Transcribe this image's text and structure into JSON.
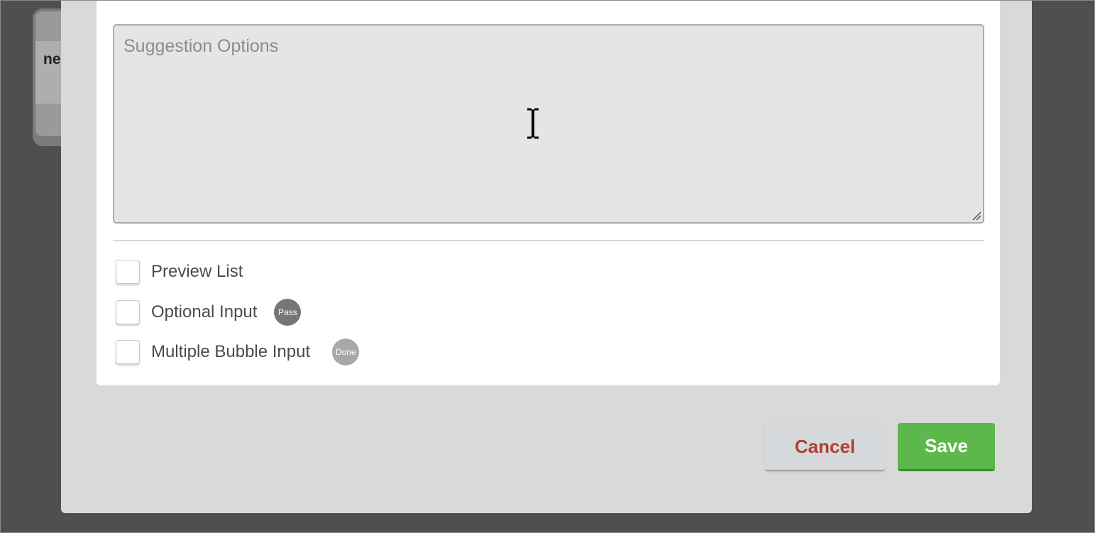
{
  "background": {
    "card_text": "ne"
  },
  "dialog": {
    "suggestion_options": {
      "value": "",
      "placeholder": "Suggestion Options"
    },
    "options": [
      {
        "label": "Preview List",
        "checked": false,
        "badge": null
      },
      {
        "label": "Optional Input",
        "checked": false,
        "badge": "Pass"
      },
      {
        "label": "Multiple Bubble Input",
        "checked": false,
        "badge": "Done"
      }
    ],
    "buttons": {
      "cancel_label": "Cancel",
      "save_label": "Save"
    }
  },
  "colors": {
    "overlay": "#4f4f4f",
    "modal_bg": "#d9d9d9",
    "panel_bg": "#ffffff",
    "save": "#5cb84a",
    "cancel_text": "#b0402f",
    "badge_pass": "#767676",
    "badge_done": "#a8a8a8"
  }
}
